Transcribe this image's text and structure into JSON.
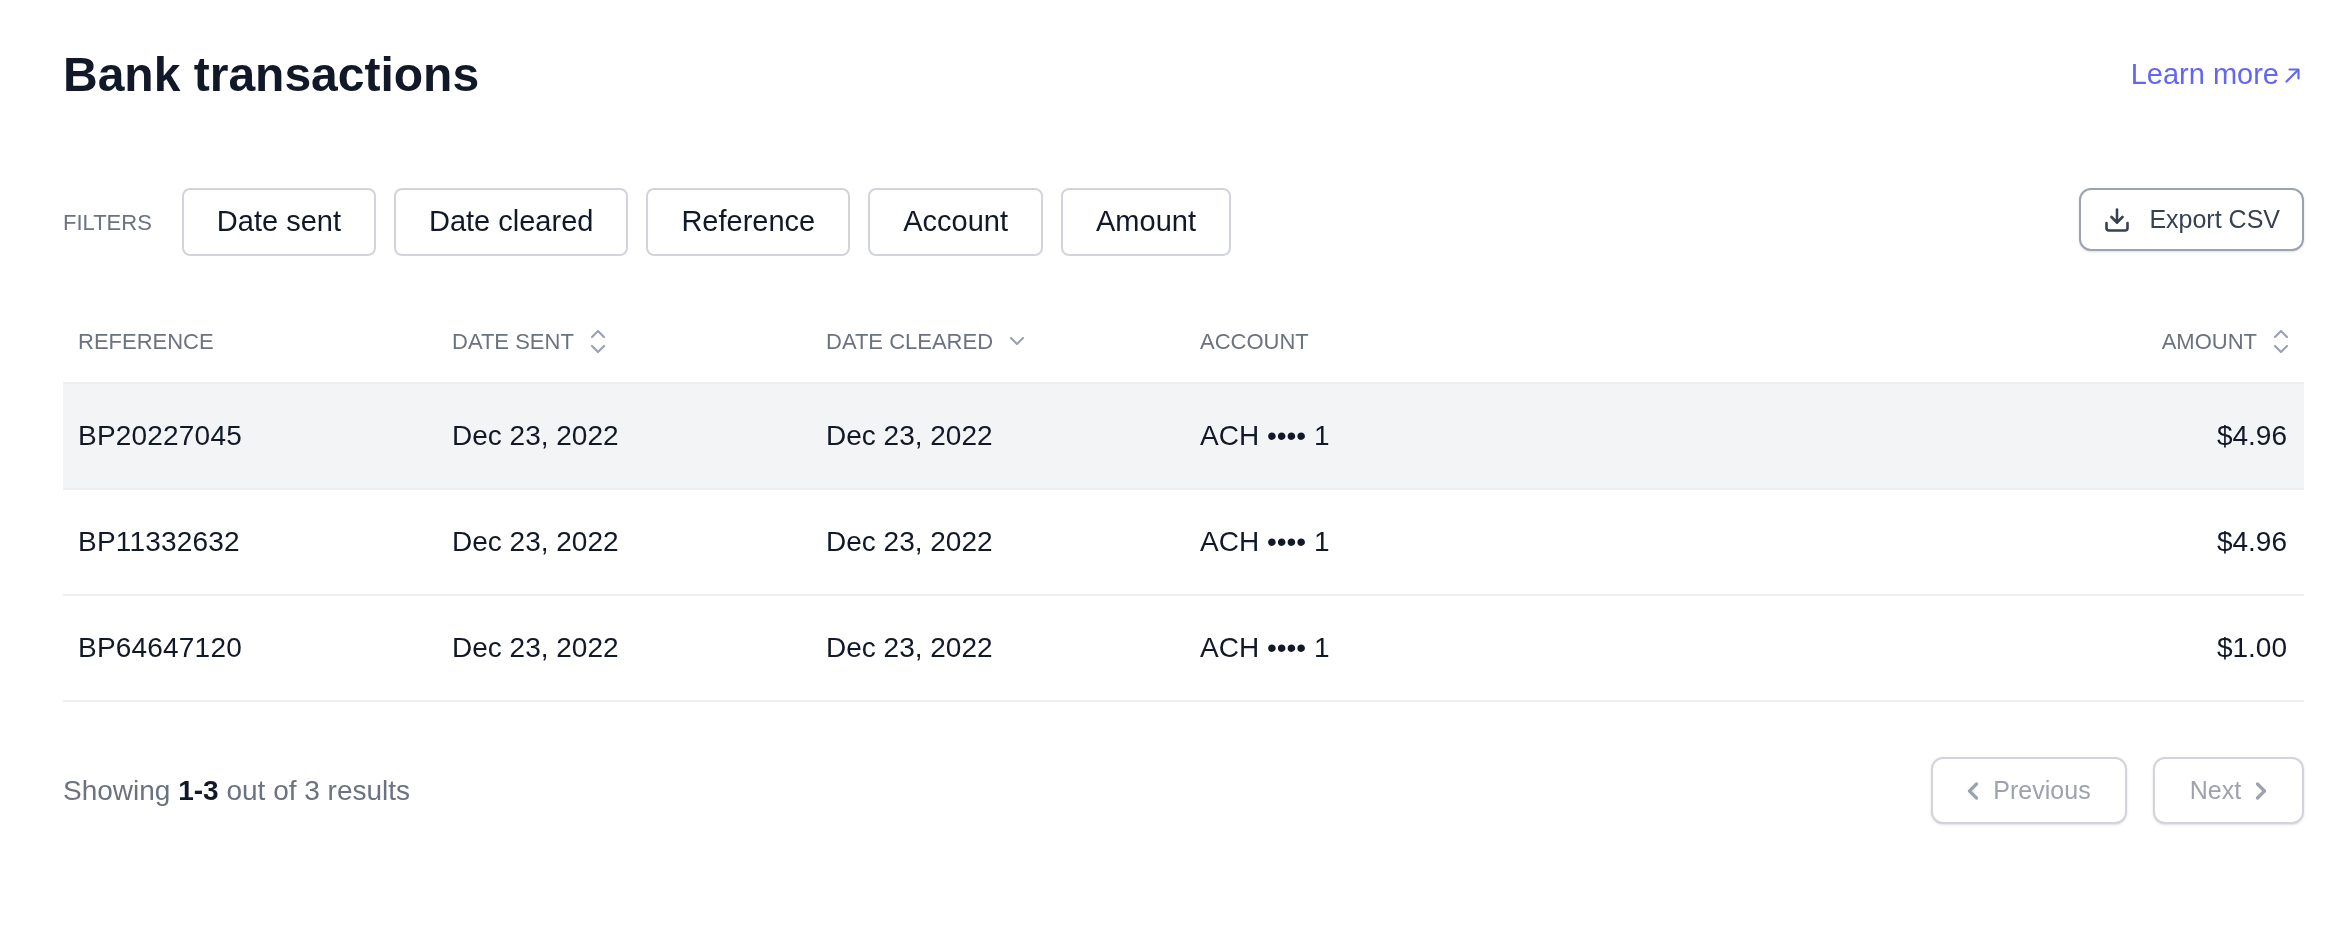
{
  "page": {
    "title": "Bank transactions",
    "learn_more": "Learn more"
  },
  "filters": {
    "label": "FILTERS",
    "buttons": [
      "Date sent",
      "Date cleared",
      "Reference",
      "Account",
      "Amount"
    ],
    "export": "Export CSV"
  },
  "table": {
    "columns": [
      {
        "label": "REFERENCE",
        "kind": "plain"
      },
      {
        "label": "DATE SENT",
        "kind": "sortable"
      },
      {
        "label": "DATE CLEARED",
        "kind": "descending"
      },
      {
        "label": "ACCOUNT",
        "kind": "plain"
      },
      {
        "label": "AMOUNT",
        "kind": "sortable"
      }
    ],
    "rows": [
      {
        "highlighted": true,
        "cells": [
          "BP20227045",
          "Dec 23, 2022",
          "Dec 23, 2022",
          "ACH •••• 1",
          "$4.96"
        ]
      },
      {
        "highlighted": false,
        "cells": [
          "BP11332632",
          "Dec 23, 2022",
          "Dec 23, 2022",
          "ACH •••• 1",
          "$4.96"
        ]
      },
      {
        "highlighted": false,
        "cells": [
          "BP64647120",
          "Dec 23, 2022",
          "Dec 23, 2022",
          "ACH •••• 1",
          "$1.00"
        ]
      }
    ]
  },
  "pagination": {
    "summary": "Showing **1-3** out of 3 results",
    "previous": {
      "label": "Previous",
      "disabled": true
    },
    "next": {
      "label": "Next",
      "disabled": true
    }
  }
}
